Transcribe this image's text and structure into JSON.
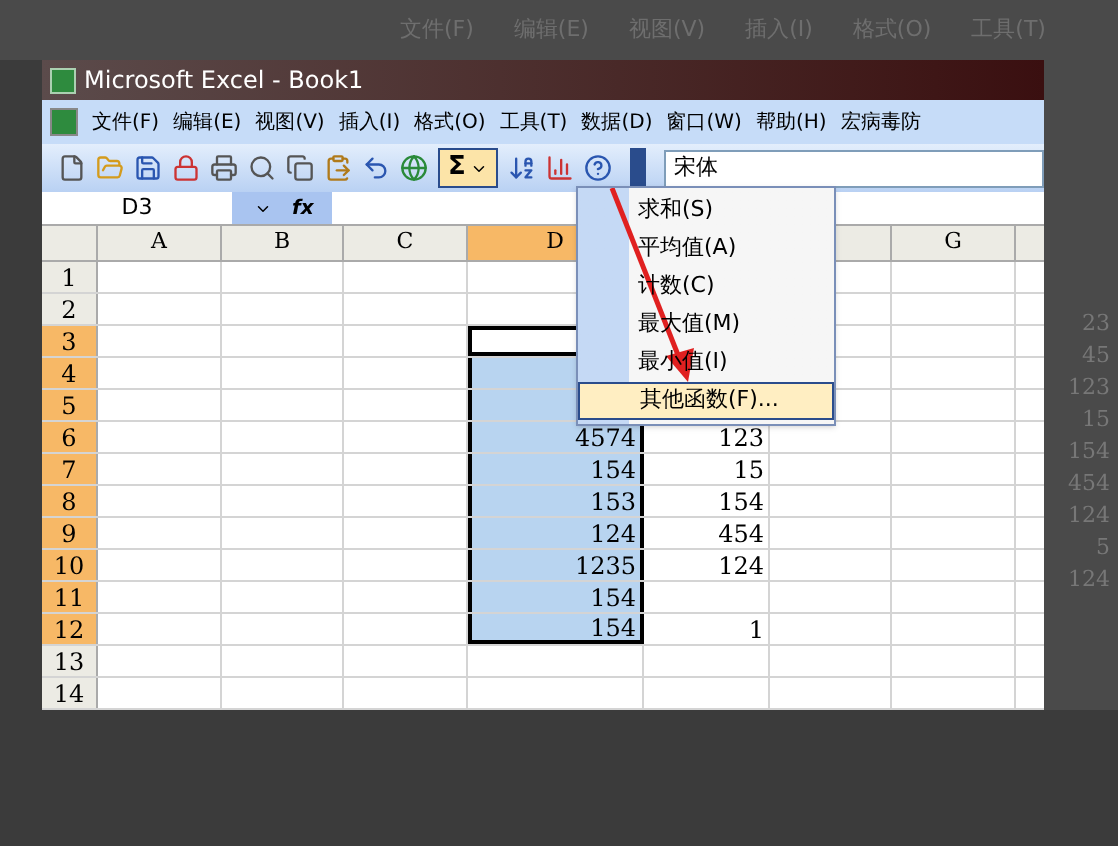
{
  "background": {
    "menu": [
      "文件(F)",
      "编辑(E)",
      "视图(V)",
      "插入(I)",
      "格式(O)",
      "工具(T)"
    ],
    "column_values": [
      "23",
      "45",
      "123",
      "15",
      "154",
      "454",
      "124",
      "5",
      "124"
    ]
  },
  "window": {
    "title": "Microsoft Excel - Book1"
  },
  "menu_bar": [
    "文件(F)",
    "编辑(E)",
    "视图(V)",
    "插入(I)",
    "格式(O)",
    "工具(T)",
    "数据(D)",
    "窗口(W)",
    "帮助(H)",
    "宏病毒防"
  ],
  "toolbar": {
    "autosum": {
      "symbol": "Σ",
      "pressed": true
    },
    "font": "宋体"
  },
  "formula_bar": {
    "name_box": "D3",
    "fx": "fx"
  },
  "columns": [
    {
      "label": "A",
      "selected": false
    },
    {
      "label": "B",
      "selected": false
    },
    {
      "label": "C",
      "selected": false
    },
    {
      "label": "D",
      "selected": true
    },
    {
      "label": "G",
      "selected": false
    }
  ],
  "rows": [
    {
      "label": "1",
      "selected": false,
      "active": false
    },
    {
      "label": "2",
      "selected": false,
      "active": false
    },
    {
      "label": "3",
      "selected": true,
      "active": true
    },
    {
      "label": "4",
      "selected": true,
      "active": false
    },
    {
      "label": "5",
      "selected": true,
      "active": false
    },
    {
      "label": "6",
      "selected": true,
      "active": false,
      "d": "4574",
      "e": "123"
    },
    {
      "label": "7",
      "selected": true,
      "active": false,
      "d": "154",
      "e": "15"
    },
    {
      "label": "8",
      "selected": true,
      "active": false,
      "d": "153",
      "e": "154"
    },
    {
      "label": "9",
      "selected": true,
      "active": false,
      "d": "124",
      "e": "454"
    },
    {
      "label": "10",
      "selected": true,
      "active": false,
      "d": "1235",
      "e": "124"
    },
    {
      "label": "11",
      "selected": true,
      "active": false,
      "d": "154"
    },
    {
      "label": "12",
      "selected": true,
      "active": false,
      "d": "154",
      "e": "1"
    },
    {
      "label": "13",
      "selected": false,
      "active": false
    },
    {
      "label": "14",
      "selected": false,
      "active": false
    }
  ],
  "autosum_menu": {
    "items": [
      {
        "label": "求和(S)",
        "selected": false
      },
      {
        "label": "平均值(A)",
        "selected": false
      },
      {
        "label": "计数(C)",
        "selected": false
      },
      {
        "label": "最大值(M)",
        "selected": false
      },
      {
        "label": "最小值(I)",
        "selected": false
      },
      {
        "label": "其他函数(F)...",
        "selected": true
      }
    ]
  }
}
